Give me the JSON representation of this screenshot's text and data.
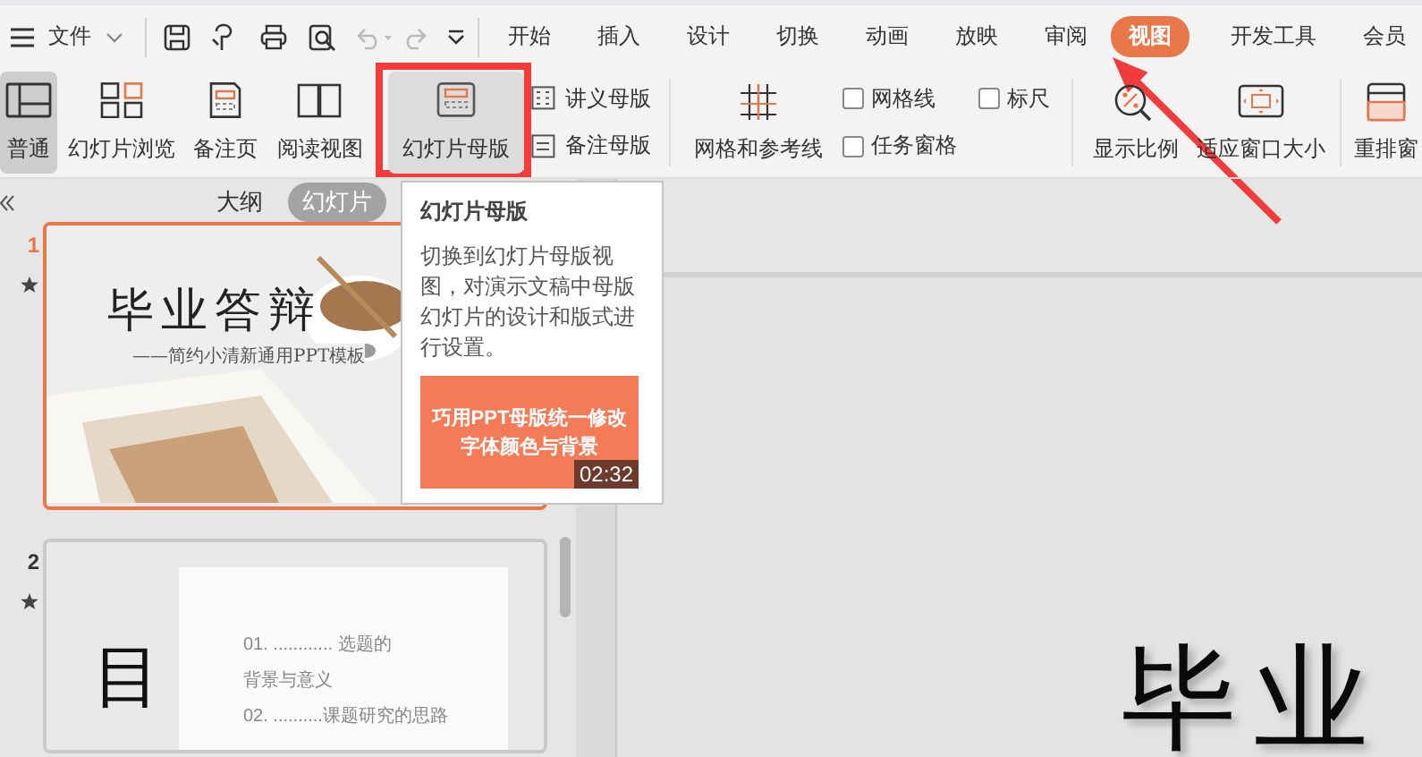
{
  "menu": {
    "file_label": "文件"
  },
  "tabs": [
    {
      "label": "开始",
      "selected": false
    },
    {
      "label": "插入",
      "selected": false
    },
    {
      "label": "设计",
      "selected": false
    },
    {
      "label": "切换",
      "selected": false
    },
    {
      "label": "动画",
      "selected": false
    },
    {
      "label": "放映",
      "selected": false
    },
    {
      "label": "审阅",
      "selected": false
    },
    {
      "label": "视图",
      "selected": true
    },
    {
      "label": "开发工具",
      "selected": false
    },
    {
      "label": "会员",
      "selected": false
    }
  ],
  "ribbon": {
    "view_buttons": [
      {
        "label": "普通",
        "selected": true,
        "hovered": false
      },
      {
        "label": "幻灯片浏览",
        "selected": false,
        "hovered": false
      },
      {
        "label": "备注页",
        "selected": false,
        "hovered": false
      },
      {
        "label": "阅读视图",
        "selected": false,
        "hovered": false
      },
      {
        "label": "幻灯片母版",
        "selected": false,
        "hovered": true
      }
    ],
    "master_buttons": [
      "讲义母版",
      "备注母版"
    ],
    "grid_button": "网格和参考线",
    "checkboxes": [
      {
        "label": "网格线",
        "checked": false
      },
      {
        "label": "标尺",
        "checked": false
      },
      {
        "label": "任务窗格",
        "checked": false
      }
    ],
    "zoom_buttons": [
      "显示比例",
      "适应窗口大小"
    ],
    "window_button": "重排窗"
  },
  "slide_panel": {
    "view_tabs": [
      {
        "label": "大纲",
        "selected": false
      },
      {
        "label": "幻灯片",
        "selected": true
      }
    ],
    "slides": [
      {
        "number": "1",
        "selected": true,
        "kind": "title",
        "title": "毕业答辩",
        "subtitle": "——简约小清新通用PPT模板"
      },
      {
        "number": "2",
        "selected": false,
        "kind": "contents",
        "title": "目",
        "entries": [
          "01. ............ 选题的",
          "背景与意义",
          "02. ..........课题研究的思路"
        ]
      }
    ]
  },
  "editor": {
    "slide_text": "毕业"
  },
  "tooltip": {
    "title": "幻灯片母版",
    "description": "切换到幻灯片母版视图，对演示文稿中母版幻灯片的设计和版式进行设置。",
    "video": {
      "caption": "巧用PPT母版统一修改字体颜色与背景",
      "duration": "02:32"
    }
  }
}
